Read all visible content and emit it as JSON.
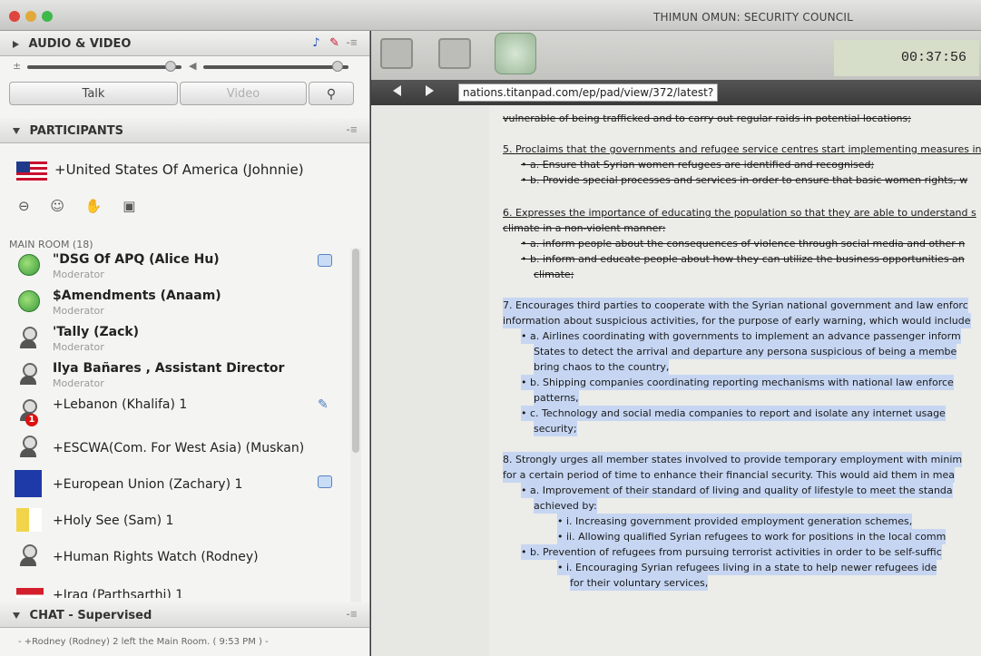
{
  "window": {
    "title": "THIMUN OMUN: SECURITY COUNCIL"
  },
  "audio_video": {
    "header": "AUDIO & VIDEO",
    "menu": "-≡",
    "talk_label": "Talk",
    "video_label": "Video"
  },
  "participants": {
    "header": "PARTICIPANTS",
    "menu": "-≡",
    "pinned_name": "+United States Of America (Johnnie)",
    "room_label": "MAIN ROOM (18)",
    "list": [
      {
        "name": "\"DSG Of APQ (Alice Hu)",
        "role": "Moderator",
        "avatar": "globe",
        "icon": "chat-icon",
        "bold": true
      },
      {
        "name": "$Amendments (Anaam)",
        "role": "Moderator",
        "avatar": "globe",
        "bold": true
      },
      {
        "name": "'Tally (Zack)",
        "role": "Moderator",
        "avatar": "person",
        "bold": true
      },
      {
        "name": "Ilya Bañares , Assistant Director",
        "role": "Moderator",
        "avatar": "person",
        "bold": true
      },
      {
        "name": "+Lebanon (Khalifa) 1",
        "role": "",
        "avatar": "person",
        "icon": "pen-icon",
        "badge": "1"
      },
      {
        "name": "+ESCWA(Com. For West Asia) (Muskan)",
        "role": "",
        "avatar": "person"
      },
      {
        "name": "+European Union (Zachary) 1",
        "role": "",
        "avatar": "eu-flag",
        "icon": "chat-icon"
      },
      {
        "name": "+Holy See (Sam) 1",
        "role": "",
        "avatar": "vatican-flag"
      },
      {
        "name": "+Human Rights Watch (Rodney)",
        "role": "",
        "avatar": "person"
      },
      {
        "name": "+Iraq (Parthsarthi) 1",
        "role": "",
        "avatar": "iraq-flag"
      }
    ]
  },
  "chat": {
    "header": "CHAT - Supervised",
    "menu": "-≡",
    "message": "- +Rodney (Rodney) 2 left the Main Room. ( 9:53 PM ) -"
  },
  "toolbar": {
    "timer": "00:37:56"
  },
  "browser": {
    "url": "nations.titanpad.com/ep/pad/view/372/latest?"
  },
  "document": {
    "lines": [
      "vulnerable of being trafficked and to carry out regular raids in potential locations;",
      "5. Proclaims that the governments and refugee service centres start implementing measures in",
      "a. Ensure that Syrian women refugees are identified and recognised;",
      "b. Provide special processes and services in order to ensure that basic women rights, w",
      "6. Expresses the importance of educating the population so that they are able to understand s",
      "climate in a non-violent manner:",
      "a. inform people about the consequences of violence through social media and other n",
      "b. inform and educate people about how they can utilize the business opportunities an",
      "climate;",
      "7. Encourages third parties to cooperate with the Syrian national government and law enforc",
      "information about suspicious activities, for the purpose of early warning, which would include",
      "a. Airlines coordinating with governments to implement an advance passenger inform",
      "States to detect the arrival and departure any persona suspicious of being a membe",
      "bring chaos to the country,",
      "b. Shipping companies coordinating reporting mechanisms with national law enforce",
      "patterns,",
      "c. Technology and social media companies to report and isolate any internet usage",
      "security;",
      "8. Strongly urges all member states involved to provide temporary employment with minim",
      "for a certain period of time to enhance their financial security. This would aid them in mea",
      "a. Improvement of their standard of living and quality of lifestyle to meet the standa",
      "achieved by:",
      "i. Increasing government provided employment generation schemes,",
      "ii. Allowing qualified Syrian refugees to work for positions in the local comm",
      "b. Prevention of refugees from pursuing terrorist activities in order to be self-suffic",
      "i. Encouraging Syrian refugees living in a state to help newer refugees ide",
      "for their voluntary services,"
    ]
  }
}
